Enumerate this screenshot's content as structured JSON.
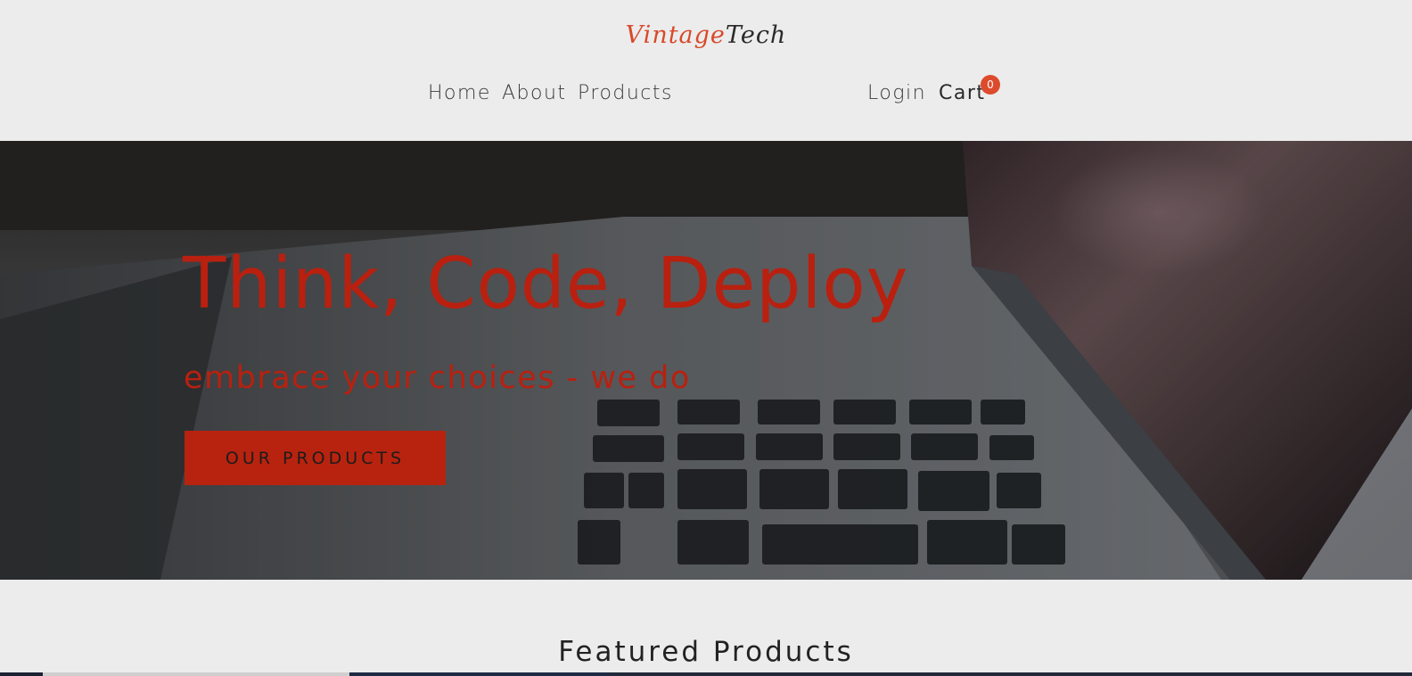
{
  "header": {
    "logo_part1": "Vintage",
    "logo_part2": "Tech",
    "nav": {
      "home": "Home",
      "about": "About",
      "products": "Products",
      "login": "Login",
      "cart": "Cart",
      "cart_count": "0"
    }
  },
  "hero": {
    "title": "Think, Code, Deploy",
    "subtitle": "embrace your choices - we do",
    "button_label": "OUR PRODUCTS"
  },
  "featured": {
    "title": "Featured Products"
  },
  "colors": {
    "accent": "#b9200f",
    "badge": "#dd4b2d",
    "background": "#ececec"
  }
}
